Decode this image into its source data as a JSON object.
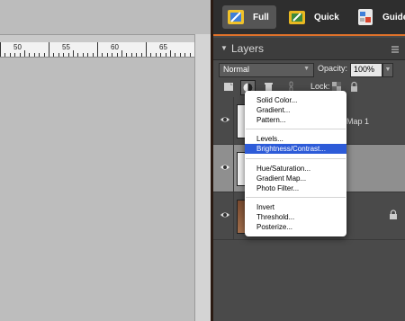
{
  "ruler": {
    "labels": [
      "50",
      "55",
      "60",
      "65"
    ]
  },
  "mode_bar": {
    "full": "Full",
    "quick": "Quick",
    "guided": "Guide"
  },
  "layers_panel": {
    "title": "Layers",
    "blend_mode": "Normal",
    "opacity_label": "Opacity:",
    "opacity_value": "100%",
    "lock_label": "Lock:",
    "layer_partial_name": "Map 1"
  },
  "adjustment_menu": {
    "groups": [
      [
        "Solid Color...",
        "Gradient...",
        "Pattern..."
      ],
      [
        "Levels...",
        "Brightness/Contrast..."
      ],
      [
        "Hue/Saturation...",
        "Gradient Map...",
        "Photo Filter..."
      ],
      [
        "Invert",
        "Threshold...",
        "Posterize..."
      ]
    ],
    "highlighted": "Brightness/Contrast..."
  },
  "colors": {
    "accent_orange": "#e0722a",
    "menu_highlight": "#2d5bd8",
    "panel_bg": "#4a4a4a"
  }
}
